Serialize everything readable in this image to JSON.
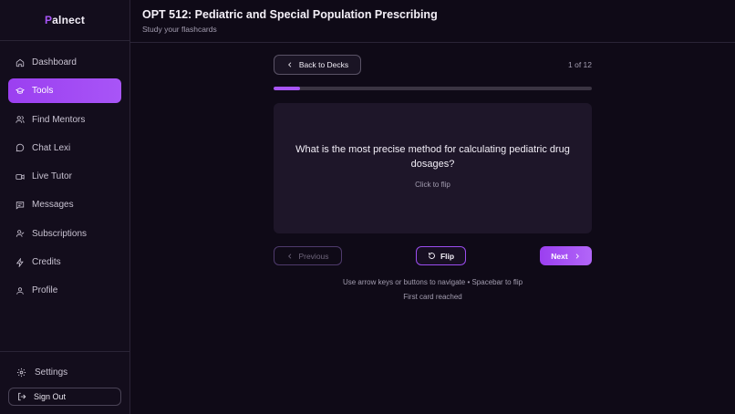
{
  "app": {
    "logo_mark": "P",
    "logo_text": "alnect"
  },
  "sidebar": {
    "items": [
      {
        "label": "Dashboard",
        "icon": "home-icon",
        "active": false
      },
      {
        "label": "Tools",
        "icon": "graduation-cap-icon",
        "active": true
      },
      {
        "label": "Find Mentors",
        "icon": "users-icon",
        "active": false
      },
      {
        "label": "Chat Lexi",
        "icon": "chat-bubble-icon",
        "active": false
      },
      {
        "label": "Live Tutor",
        "icon": "video-icon",
        "active": false
      },
      {
        "label": "Messages",
        "icon": "message-square-icon",
        "active": false
      },
      {
        "label": "Subscriptions",
        "icon": "user-check-icon",
        "active": false
      },
      {
        "label": "Credits",
        "icon": "lightning-icon",
        "active": false
      },
      {
        "label": "Profile",
        "icon": "user-icon",
        "active": false
      }
    ],
    "settings_label": "Settings",
    "signout_label": "Sign Out"
  },
  "header": {
    "title": "OPT 512: Pediatric and Special Population Prescribing",
    "subtitle": "Study your flashcards"
  },
  "deck": {
    "back_label": "Back to Decks",
    "counter": "1 of 12",
    "progress": 0.083
  },
  "card": {
    "question": "What is the most precise method for calculating pediatric drug dosages?",
    "hint": "Click to flip"
  },
  "controls": {
    "previous_label": "Previous",
    "flip_label": "Flip",
    "next_label": "Next"
  },
  "footer": {
    "help": "Use arrow keys or buttons to navigate • Spacebar to flip",
    "status": "First card reached"
  },
  "colors": {
    "accent": "#a855f7",
    "background": "#0f0a17",
    "sidebar": "#130d1c",
    "card": "#1e1629"
  }
}
